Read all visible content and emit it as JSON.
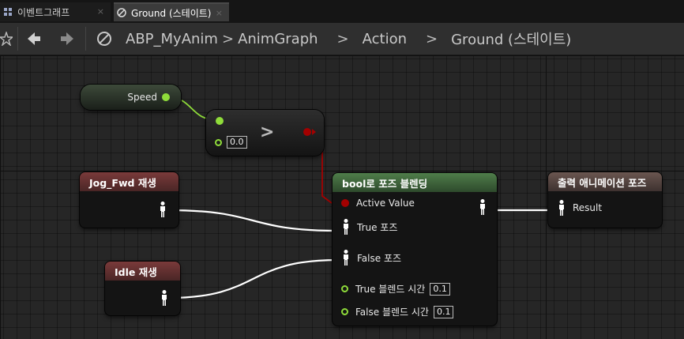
{
  "tabs": [
    {
      "label": "이벤트그래프",
      "close": "×"
    },
    {
      "label": "Ground (스테이트)",
      "close": "×"
    }
  ],
  "breadcrumb": {
    "items": [
      "ABP_MyAnim",
      "AnimGraph",
      "Action",
      "Ground (스테이트)"
    ],
    "separator": ">"
  },
  "nodes": {
    "speed": {
      "label": "Speed"
    },
    "compare": {
      "operator": ">",
      "value": "0.0"
    },
    "jog": {
      "title": "Jog_Fwd 재생"
    },
    "idle": {
      "title": "Idle 재생"
    },
    "blend": {
      "title": "bool로 포즈 블렌딩",
      "active_value": "Active Value",
      "true_pose": "True 포즈",
      "false_pose": "False 포즈",
      "true_blend_time": "True 블렌드 시간",
      "true_blend_value": "0.1",
      "false_blend_time": "False 블렌드 시간",
      "false_blend_value": "0.1"
    },
    "output": {
      "title": "출력 애니메이션 포즈",
      "result": "Result"
    }
  },
  "colors": {
    "bool_pin": "#a30000",
    "float_pin": "#8fdc3a",
    "pose_wire": "#ffffff",
    "blend_header": "#3f6a3c",
    "play_header": "#6a2f2f",
    "output_header": "#5a4640"
  }
}
